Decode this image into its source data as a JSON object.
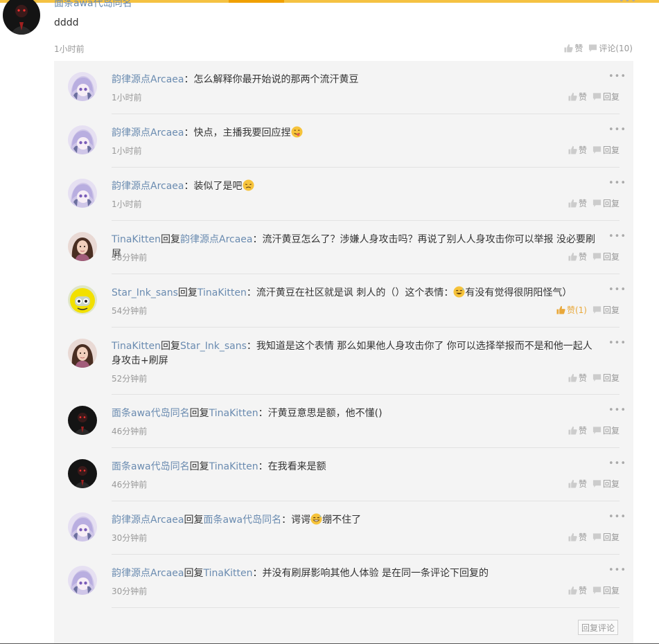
{
  "main_comment": {
    "author": "面条awa代岛同名",
    "content": "dddd",
    "time": "1小时前",
    "like_label": "赞",
    "comment_label": "评论(10)"
  },
  "reply_action_labels": {
    "like": "赞",
    "reply": "回复"
  },
  "reply_comment_label": "回复评论",
  "replies": [
    {
      "author": "韵律源点Arcaea",
      "reply_word": "",
      "target": "",
      "separator": "：",
      "content": "怎么解释你最开始说的那两个流汗黄豆",
      "emoji_after": "",
      "content_tail": "",
      "time": "1小时前",
      "like_label": "赞",
      "avatar": "arcaea"
    },
    {
      "author": "韵律源点Arcaea",
      "reply_word": "",
      "target": "",
      "separator": "：",
      "content": "快点，主播我要回应捏",
      "emoji_after": "yum-face-emoji",
      "content_tail": "",
      "time": "1小时前",
      "like_label": "赞",
      "avatar": "arcaea"
    },
    {
      "author": "韵律源点Arcaea",
      "reply_word": "",
      "target": "",
      "separator": "：",
      "content": "装似了是吧",
      "emoji_after": "disappointed-face-emoji",
      "content_tail": "",
      "time": "1小时前",
      "like_label": "赞",
      "avatar": "arcaea"
    },
    {
      "author": "TinaKitten",
      "reply_word": "回复",
      "target": "韵律源点Arcaea",
      "separator": "：",
      "content": "流汗黄豆怎么了？涉嫌人身攻击吗？再说了别人人身攻击你可以举报 没必要刷屏",
      "emoji_after": "",
      "content_tail": "",
      "time": "58分钟前",
      "like_label": "赞",
      "avatar": "tina"
    },
    {
      "author": "Star_Ink_sans",
      "reply_word": "回复",
      "target": "TinaKitten",
      "separator": "：",
      "content": "流汗黄豆在社区就是讽 刺人的（）这个表情：",
      "emoji_after": "sweat-smile-emoji",
      "content_tail": "有没有觉得很阴阳怪气）",
      "time": "54分钟前",
      "like_label": "赞(1)",
      "liked": true,
      "avatar": "star"
    },
    {
      "author": "TinaKitten",
      "reply_word": "回复",
      "target": "Star_Ink_sans",
      "separator": "：",
      "content": "我知道是这个表情 那么如果他人身攻击你了 你可以选择举报而不是和他一起人身攻击+刷屏",
      "emoji_after": "",
      "content_tail": "",
      "time": "52分钟前",
      "like_label": "赞",
      "avatar": "tina"
    },
    {
      "author": "面条awa代岛同名",
      "reply_word": "回复",
      "target": "TinaKitten",
      "separator": "：",
      "content": "汗黄豆意思是额，他不懂()",
      "emoji_after": "",
      "content_tail": "",
      "time": "46分钟前",
      "like_label": "赞",
      "avatar": "noodle"
    },
    {
      "author": "面条awa代岛同名",
      "reply_word": "回复",
      "target": "TinaKitten",
      "separator": "：",
      "content": "在我看来是额",
      "emoji_after": "",
      "content_tail": "",
      "time": "46分钟前",
      "like_label": "赞",
      "avatar": "noodle"
    },
    {
      "author": "韵律源点Arcaea",
      "reply_word": "回复",
      "target": "面条awa代岛同名",
      "separator": "：",
      "content": "谔谔",
      "emoji_after": "grin-sweat-emoji",
      "content_tail": "绷不住了",
      "time": "30分钟前",
      "like_label": "赞",
      "avatar": "arcaea"
    },
    {
      "author": "韵律源点Arcaea",
      "reply_word": "回复",
      "target": "TinaKitten",
      "separator": "：",
      "content": "并没有刷屏影响其他人体验 是在同一条评论下回复的",
      "emoji_after": "",
      "content_tail": "",
      "time": "30分钟前",
      "like_label": "赞",
      "avatar": "arcaea"
    }
  ]
}
